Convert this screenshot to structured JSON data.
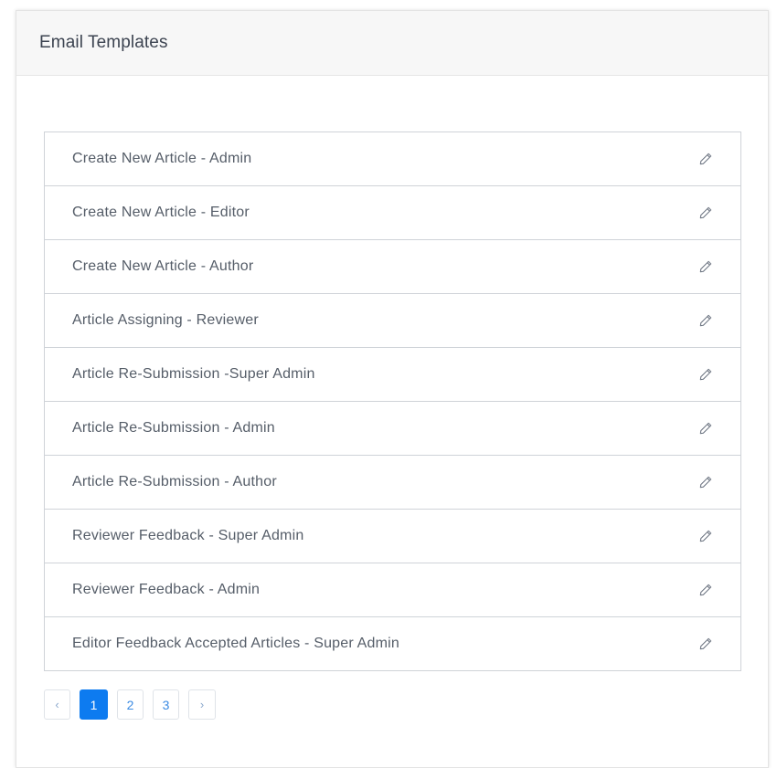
{
  "card": {
    "title": "Email Templates"
  },
  "templates": [
    {
      "label": "Create New Article - Admin",
      "icon": "pencil-icon"
    },
    {
      "label": "Create New Article - Editor",
      "icon": "pencil-icon"
    },
    {
      "label": "Create New Article - Author",
      "icon": "pencil-icon"
    },
    {
      "label": "Article Assigning - Reviewer",
      "icon": "pencil-icon"
    },
    {
      "label": "Article Re-Submission -Super Admin",
      "icon": "pencil-icon"
    },
    {
      "label": "Article Re-Submission - Admin",
      "icon": "pencil-icon"
    },
    {
      "label": "Article Re-Submission - Author",
      "icon": "pencil-icon"
    },
    {
      "label": "Reviewer Feedback - Super Admin",
      "icon": "pencil-icon"
    },
    {
      "label": "Reviewer Feedback - Admin",
      "icon": "pencil-icon"
    },
    {
      "label": "Editor Feedback Accepted Articles - Super Admin",
      "icon": "pencil-icon"
    }
  ],
  "pagination": {
    "prev_label": "‹",
    "pages": [
      "1",
      "2",
      "3"
    ],
    "active_page": "1",
    "next_label": "›"
  },
  "colors": {
    "accent": "#0d7bf0",
    "text": "#555d68",
    "border": "#cfd3d8",
    "header_bg": "#f7f7f7"
  }
}
